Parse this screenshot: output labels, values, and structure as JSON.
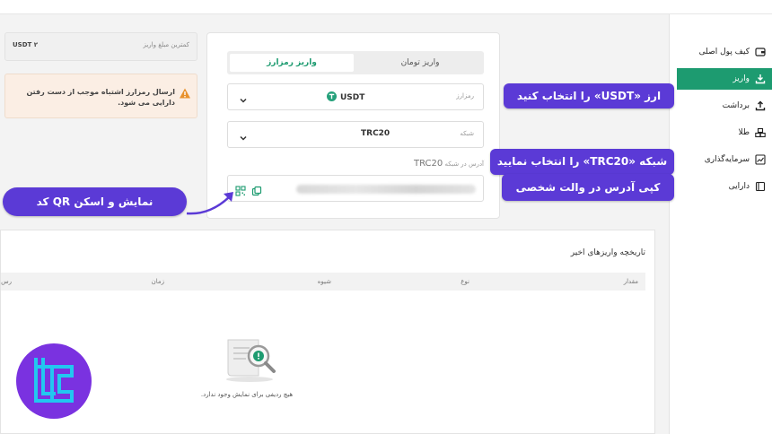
{
  "topbar": {
    "nav": [
      "",
      "",
      "",
      "",
      "",
      ""
    ]
  },
  "sidebar": {
    "items": [
      {
        "label": "کیف پول اصلی",
        "icon": "wallet-icon",
        "active": false
      },
      {
        "label": "واریز",
        "icon": "download-icon",
        "active": true
      },
      {
        "label": "برداشت",
        "icon": "upload-icon",
        "active": false
      },
      {
        "label": "طلا",
        "icon": "gold-bars-icon",
        "active": false
      },
      {
        "label": "سرمایه‌گذاری",
        "icon": "chart-icon",
        "active": false
      },
      {
        "label": "دارایی",
        "icon": "assets-icon",
        "active": false
      }
    ],
    "accent": "#1d9b70"
  },
  "deposit": {
    "tabs": [
      {
        "label": "واریز تومان",
        "active": false
      },
      {
        "label": "واریز رمزارز",
        "active": true
      }
    ],
    "currency": {
      "label": "رمزارز",
      "value": "USDT",
      "icon": "tether-icon"
    },
    "network": {
      "label": "شبکه",
      "value": "TRC20"
    },
    "address": {
      "label_prefix": "آدرس در شبکه",
      "network": "TRC20"
    }
  },
  "info": {
    "min_label": "کمترین مبلغ واریز",
    "min_value": "USDT ۲",
    "warning": "ارسال رمزارز اشتباه موجب از دست رفتن دارایی می شود."
  },
  "history": {
    "title": "تاریخچه واریزهای اخیر",
    "columns": [
      "مقدار",
      "نوع",
      "شیوه",
      "زمان",
      "رس"
    ],
    "empty_text": "هیچ ردیفی برای نمایش وجود ندارد."
  },
  "callouts": {
    "select_currency": "ارز «USDT» را انتخاب کنید",
    "select_network": "شبکه «TRC20» را انتخاب نمایید",
    "copy_address": "کپی آدرس در والت شخصی",
    "qr": "نمایش و اسکن QR کد",
    "color": "#5b3ad6"
  },
  "logo": {
    "icon": "tc-logo",
    "color": "#7a32e0"
  }
}
